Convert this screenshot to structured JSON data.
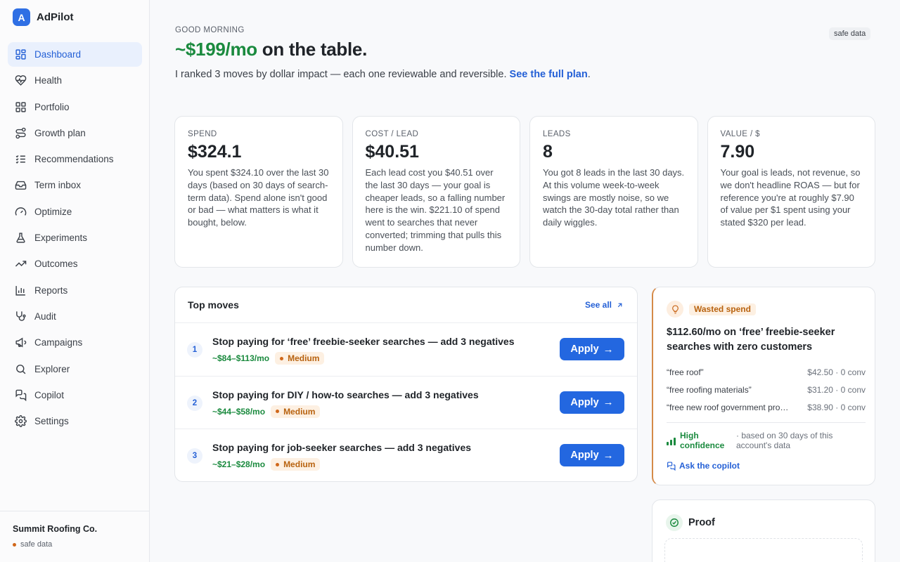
{
  "brand": {
    "letter": "A",
    "name": "AdPilot"
  },
  "sidebar": {
    "items": [
      {
        "label": "Dashboard",
        "icon": "grid-icon",
        "active": true
      },
      {
        "label": "Health",
        "icon": "heart-pulse-icon"
      },
      {
        "label": "Portfolio",
        "icon": "grid-icon"
      },
      {
        "label": "Growth plan",
        "icon": "route-icon"
      },
      {
        "label": "Recommendations",
        "icon": "list-check-icon"
      },
      {
        "label": "Term inbox",
        "icon": "inbox-icon"
      },
      {
        "label": "Optimize",
        "icon": "gauge-icon"
      },
      {
        "label": "Experiments",
        "icon": "flask-icon"
      },
      {
        "label": "Outcomes",
        "icon": "trending-up-icon"
      },
      {
        "label": "Reports",
        "icon": "bar-chart-icon"
      },
      {
        "label": "Audit",
        "icon": "stethoscope-icon"
      },
      {
        "label": "Campaigns",
        "icon": "megaphone-icon"
      },
      {
        "label": "Explorer",
        "icon": "search-icon"
      },
      {
        "label": "Copilot",
        "icon": "chat-icon"
      },
      {
        "label": "Settings",
        "icon": "gear-icon"
      }
    ],
    "account": {
      "name": "Summit Roofing Co.",
      "status": "safe data"
    }
  },
  "header": {
    "greeting": "GOOD MORNING",
    "hero_amount": "~$199/mo",
    "hero_rest": " on the table.",
    "safe_pill": "safe data",
    "subline": "I ranked 3 moves by dollar impact — each one reviewable and reversible. ",
    "subline_link": "See the full plan",
    "subline_end": "."
  },
  "kpis": [
    {
      "label": "SPEND",
      "value": "$324.1",
      "desc": "You spent $324.10 over the last 30 days (based on 30 days of search-term data). Spend alone isn't good or bad — what matters is what it bought, below."
    },
    {
      "label": "COST / LEAD",
      "value": "$40.51",
      "desc": "Each lead cost you $40.51 over the last 30 days — your goal is cheaper leads, so a falling number here is the win. $221.10 of spend went to searches that never converted; trimming that pulls this number down."
    },
    {
      "label": "LEADS",
      "value": "8",
      "desc": "You got 8 leads in the last 30 days. At this volume week-to-week swings are mostly noise, so we watch the 30-day total rather than daily wiggles."
    },
    {
      "label": "VALUE / $",
      "value": "7.90",
      "desc": "Your goal is leads, not revenue, so we don't headline ROAS — but for reference you're at roughly $7.90 of value per $1 spent using your stated $320 per lead."
    }
  ],
  "moves": {
    "title": "Top moves",
    "see_all": "See all",
    "apply_label": "Apply",
    "items": [
      {
        "num": "1",
        "title": "Stop paying for ‘free’ freebie-seeker searches — add 3 negatives",
        "range": "~$84–$113/mo",
        "badge": "Medium"
      },
      {
        "num": "2",
        "title": "Stop paying for DIY / how-to searches — add 3 negatives",
        "range": "~$44–$58/mo",
        "badge": "Medium"
      },
      {
        "num": "3",
        "title": "Stop paying for job-seeker searches — add 3 negatives",
        "range": "~$21–$28/mo",
        "badge": "Medium"
      }
    ]
  },
  "waste": {
    "tag": "Wasted spend",
    "title": "$112.60/mo on ‘free’ freebie-seeker searches with zero customers",
    "terms": [
      {
        "term": "“free roof”",
        "value": "$42.50 · 0 conv"
      },
      {
        "term": "“free roofing materials”",
        "value": "$31.20 · 0 conv"
      },
      {
        "term": "“free new roof government program”",
        "value": "$38.90 · 0 conv"
      }
    ],
    "confidence": "High confidence",
    "confidence_note": "· based on 30 days of this account's data",
    "ask": "Ask the copilot"
  },
  "proof": {
    "title": "Proof"
  },
  "colors": {
    "accent": "#2367e0",
    "positive": "#1a8a3e",
    "warning": "#d0671a"
  }
}
